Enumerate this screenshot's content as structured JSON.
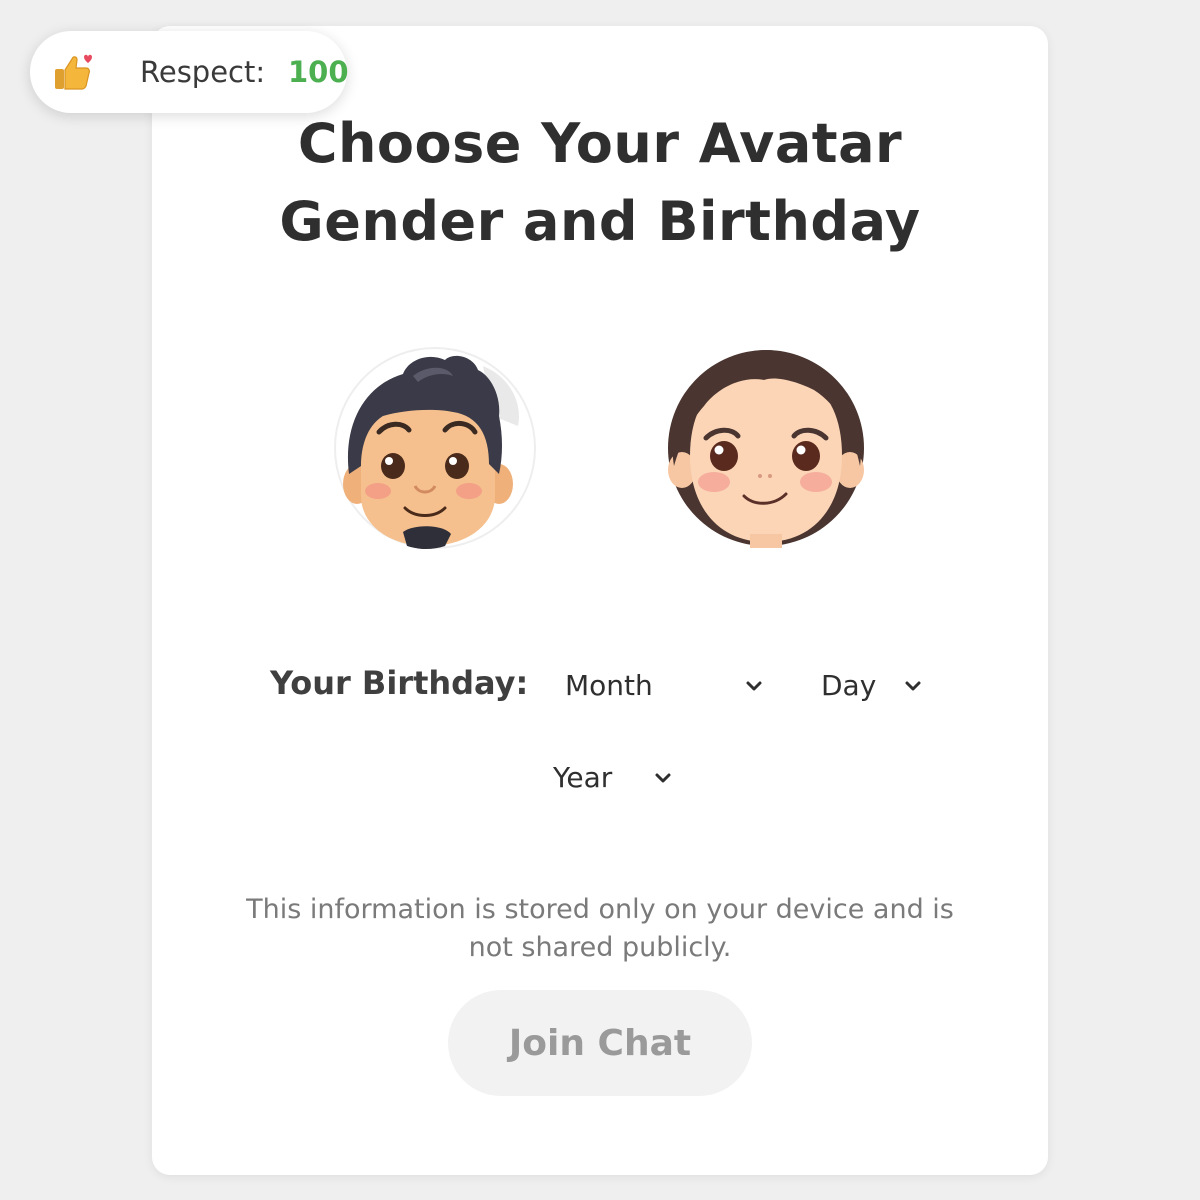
{
  "respect": {
    "label": "Respect:",
    "value": "100",
    "icon": "thumbs-up-heart-icon",
    "value_color": "#4caf50"
  },
  "title": {
    "line1": "Choose Your Avatar",
    "line2": "Gender and Birthday"
  },
  "avatars": [
    {
      "name": "male-avatar"
    },
    {
      "name": "female-avatar"
    }
  ],
  "birthday": {
    "label": "Your Birthday:",
    "month_placeholder": "Month",
    "day_placeholder": "Day",
    "year_placeholder": "Year"
  },
  "info_text": "This information is stored only on your device and is not shared publicly.",
  "join_button": {
    "label": "Join Chat",
    "state": "disabled"
  }
}
